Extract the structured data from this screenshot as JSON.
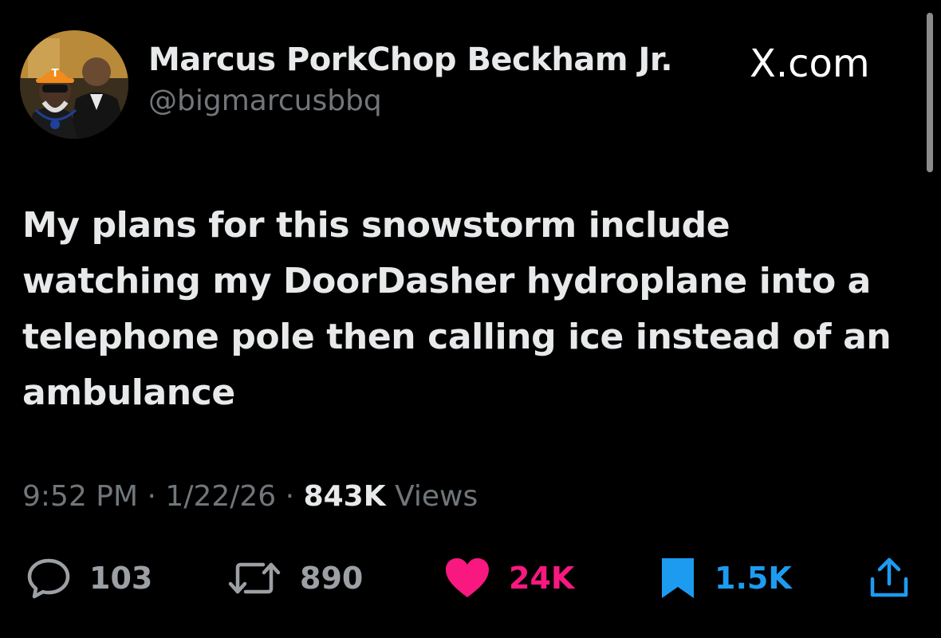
{
  "header": {
    "display_name": "Marcus PorkChop Beckham Jr.",
    "handle": "@bigmarcusbbq",
    "brand": "X.com"
  },
  "avatar": {
    "icon": "profile-photo-icon",
    "cap_letter": "T"
  },
  "tweet": {
    "text": "My plans for this snowstorm include watching my DoorDasher hydroplane into a telephone pole then calling ice instead of an ambulance"
  },
  "meta": {
    "time": "9:52 PM",
    "separator": "·",
    "date": "1/22/26",
    "views_count": "843K",
    "views_label": "Views"
  },
  "actions": {
    "reply": {
      "icon": "reply-icon",
      "count": "103"
    },
    "repost": {
      "icon": "repost-icon",
      "count": "890"
    },
    "like": {
      "icon": "heart-icon",
      "count": "24K",
      "color": "#f91880"
    },
    "bookmark": {
      "icon": "bookmark-icon",
      "count": "1.5K",
      "color": "#1d9bf0"
    },
    "share": {
      "icon": "share-icon"
    }
  },
  "colors": {
    "background": "#000000",
    "text_primary": "#e7e9ea",
    "text_secondary": "#71767b",
    "like": "#f91880",
    "bookmark": "#1d9bf0"
  }
}
